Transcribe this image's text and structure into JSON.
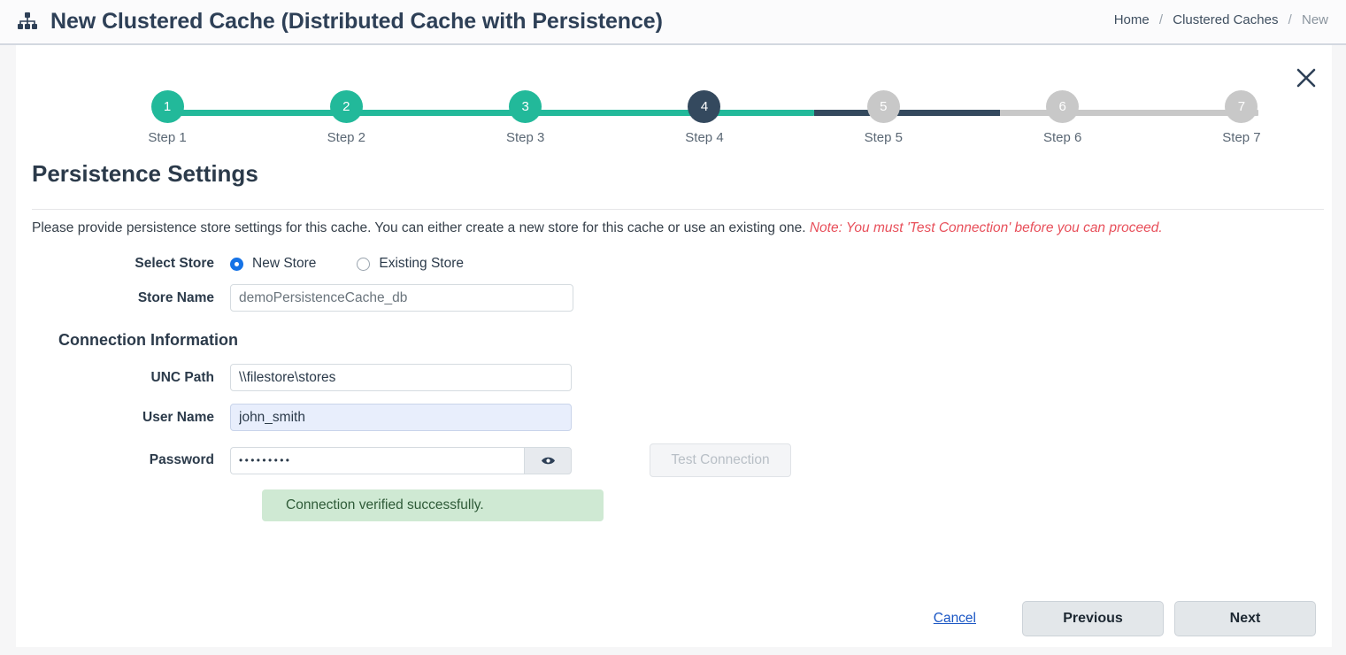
{
  "header": {
    "icon": "sitemap-icon",
    "title": "New Clustered Cache (Distributed Cache with Persistence)",
    "breadcrumb": {
      "home": "Home",
      "section": "Clustered Caches",
      "current": "New",
      "separator": "/"
    },
    "close_icon": "close-icon"
  },
  "stepper": {
    "steps": [
      {
        "number": "1",
        "label": "Step 1",
        "state": "done"
      },
      {
        "number": "2",
        "label": "Step 2",
        "state": "done"
      },
      {
        "number": "3",
        "label": "Step 3",
        "state": "done"
      },
      {
        "number": "4",
        "label": "Step 4",
        "state": "active"
      },
      {
        "number": "5",
        "label": "Step 5",
        "state": "todo"
      },
      {
        "number": "6",
        "label": "Step 6",
        "state": "todo"
      },
      {
        "number": "7",
        "label": "Step 7",
        "state": "todo"
      }
    ],
    "current_step": 4,
    "total_steps": 7,
    "colors": {
      "done": "#22b99a",
      "active": "#34495e",
      "todo": "#c8c8c8"
    }
  },
  "page": {
    "section_title": "Persistence Settings",
    "intro_text": "Please provide persistence store settings for this cache. You can either create a new store for this cache or use an existing one.",
    "intro_note": "Note: You must 'Test Connection' before you can proceed.",
    "note_color": "#e8505b"
  },
  "form": {
    "select_store": {
      "label": "Select Store",
      "options": [
        {
          "label": "New Store",
          "selected": true
        },
        {
          "label": "Existing Store",
          "selected": false
        }
      ],
      "accent_color": "#1673e6"
    },
    "store_name": {
      "label": "Store Name",
      "value": "demoPersistenceCache_db"
    },
    "connection_heading": "Connection Information",
    "unc_path": {
      "label": "UNC Path",
      "value": "\\\\filestore\\stores"
    },
    "user_name": {
      "label": "User Name",
      "value": "john_smith"
    },
    "password": {
      "label": "Password",
      "value": "•••••••••",
      "toggle_icon": "eye-icon"
    },
    "test_connection": {
      "label": "Test Connection",
      "disabled": true
    },
    "status_message": {
      "text": "Connection verified successfully.",
      "type": "success",
      "background": "#cfe9d3",
      "color": "#2f5b38"
    }
  },
  "footer": {
    "cancel": "Cancel",
    "previous": "Previous",
    "next": "Next"
  }
}
